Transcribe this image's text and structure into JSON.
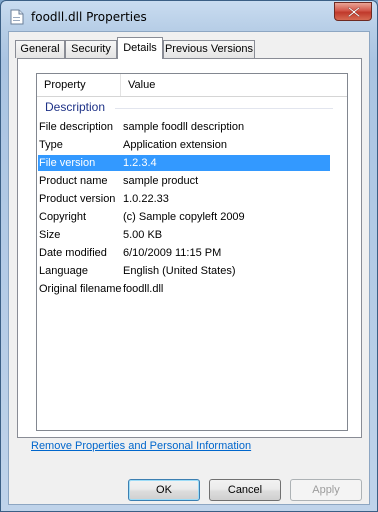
{
  "window": {
    "title": "foodll.dll Properties",
    "icons": {
      "app": "document-icon",
      "close": "close-icon"
    },
    "colors": {
      "selection": "#3399ff",
      "group_header": "#1e3287",
      "link": "#0066cc",
      "close": "#c0392b"
    }
  },
  "tabs": [
    {
      "label": "General",
      "active": false
    },
    {
      "label": "Security",
      "active": false
    },
    {
      "label": "Details",
      "active": true
    },
    {
      "label": "Previous Versions",
      "active": false
    }
  ],
  "details": {
    "columns": {
      "property": "Property",
      "value": "Value"
    },
    "group": "Description",
    "rows": [
      {
        "property": "File description",
        "value": "sample foodll description",
        "selected": false
      },
      {
        "property": "Type",
        "value": "Application extension",
        "selected": false
      },
      {
        "property": "File version",
        "value": "1.2.3.4",
        "selected": true
      },
      {
        "property": "Product name",
        "value": "sample product",
        "selected": false
      },
      {
        "property": "Product version",
        "value": "1.0.22.33",
        "selected": false
      },
      {
        "property": "Copyright",
        "value": "(c) Sample copyleft 2009",
        "selected": false
      },
      {
        "property": "Size",
        "value": "5.00 KB",
        "selected": false
      },
      {
        "property": "Date modified",
        "value": "6/10/2009 11:15 PM",
        "selected": false
      },
      {
        "property": "Language",
        "value": "English (United States)",
        "selected": false
      },
      {
        "property": "Original filename",
        "value": "foodll.dll",
        "selected": false
      }
    ]
  },
  "remove_link": "Remove Properties and Personal Information",
  "buttons": {
    "ok": "OK",
    "cancel": "Cancel",
    "apply": "Apply"
  }
}
